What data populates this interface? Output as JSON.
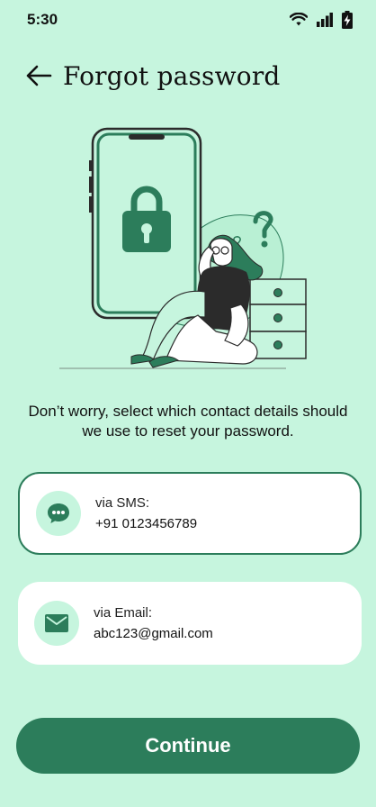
{
  "status_bar": {
    "time": "5:30",
    "icons": [
      "wifi-icon",
      "cellular-signal-icon",
      "battery-charging-icon"
    ]
  },
  "header": {
    "back_icon": "arrow-left-icon",
    "title": "Forgot password"
  },
  "instruction": "Don’t worry, select which contact details should we use to reset your password.",
  "options": [
    {
      "label": "via SMS:",
      "value": "+91 0123456789",
      "icon": "chat-bubble-icon",
      "selected": true
    },
    {
      "label": "via Email:",
      "value": "abc123@gmail.com",
      "icon": "mail-icon",
      "selected": false
    }
  ],
  "continue_label": "Continue",
  "colors": {
    "background": "#c6f5de",
    "accent": "#2c7d5b",
    "card": "#ffffff"
  }
}
